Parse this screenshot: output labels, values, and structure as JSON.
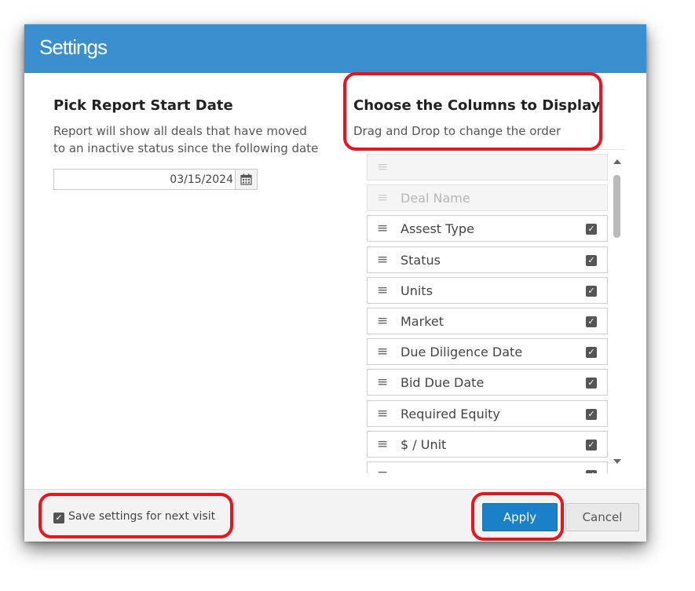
{
  "dialog": {
    "title": "Settings"
  },
  "date_section": {
    "heading": "Pick Report Start Date",
    "description_line1": "Report will show all deals that have moved",
    "description_line2": "to an inactive status since the following date",
    "date_value": "03/15/2024",
    "calendar_icon": "calendar-icon"
  },
  "columns_section": {
    "heading": "Choose the Columns to Display",
    "description": "Drag and Drop to change the order",
    "handle_icon": "drag-handle-icon",
    "items": [
      {
        "label": "",
        "checked": false,
        "disabled": true
      },
      {
        "label": "Deal Name",
        "checked": false,
        "disabled": true
      },
      {
        "label": "Assest Type",
        "checked": true,
        "disabled": false
      },
      {
        "label": "Status",
        "checked": true,
        "disabled": false
      },
      {
        "label": "Units",
        "checked": true,
        "disabled": false
      },
      {
        "label": "Market",
        "checked": true,
        "disabled": false
      },
      {
        "label": "Due Diligence Date",
        "checked": true,
        "disabled": false
      },
      {
        "label": "Bid Due Date",
        "checked": true,
        "disabled": false
      },
      {
        "label": "Required Equity",
        "checked": true,
        "disabled": false
      },
      {
        "label": "$ / Unit",
        "checked": true,
        "disabled": false
      },
      {
        "label": "",
        "checked": true,
        "disabled": false
      }
    ]
  },
  "footer": {
    "save_label": "Save settings for next visit",
    "save_checked": true,
    "apply_label": "Apply",
    "cancel_label": "Cancel"
  },
  "colors": {
    "titlebar": "#3a8fce",
    "apply_button": "#1a80c8",
    "annotation": "#e8141e"
  }
}
